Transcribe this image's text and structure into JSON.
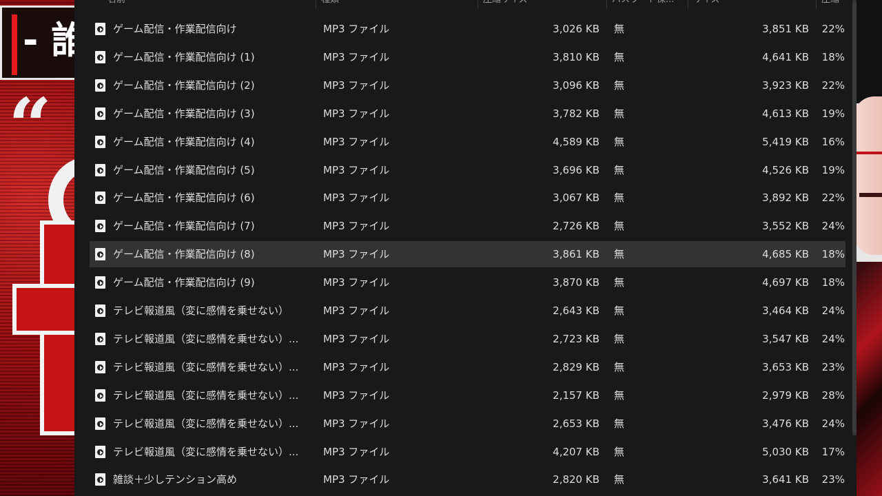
{
  "header": {
    "columns": [
      "名前",
      "種類",
      "圧縮サイズ",
      "パスワード保...",
      "サイズ",
      "圧縮"
    ]
  },
  "rows": [
    {
      "name": "ゲーム配信・作業配信向け",
      "type": "MP3 ファイル",
      "compressed": "3,026 KB",
      "password": "無",
      "size": "3,851 KB",
      "ratio": "22%"
    },
    {
      "name": "ゲーム配信・作業配信向け (1)",
      "type": "MP3 ファイル",
      "compressed": "3,810 KB",
      "password": "無",
      "size": "4,641 KB",
      "ratio": "18%"
    },
    {
      "name": "ゲーム配信・作業配信向け (2)",
      "type": "MP3 ファイル",
      "compressed": "3,096 KB",
      "password": "無",
      "size": "3,923 KB",
      "ratio": "22%"
    },
    {
      "name": "ゲーム配信・作業配信向け (3)",
      "type": "MP3 ファイル",
      "compressed": "3,782 KB",
      "password": "無",
      "size": "4,613 KB",
      "ratio": "19%"
    },
    {
      "name": "ゲーム配信・作業配信向け (4)",
      "type": "MP3 ファイル",
      "compressed": "4,589 KB",
      "password": "無",
      "size": "5,419 KB",
      "ratio": "16%"
    },
    {
      "name": "ゲーム配信・作業配信向け (5)",
      "type": "MP3 ファイル",
      "compressed": "3,696 KB",
      "password": "無",
      "size": "4,526 KB",
      "ratio": "19%"
    },
    {
      "name": "ゲーム配信・作業配信向け (6)",
      "type": "MP3 ファイル",
      "compressed": "3,067 KB",
      "password": "無",
      "size": "3,892 KB",
      "ratio": "22%"
    },
    {
      "name": "ゲーム配信・作業配信向け (7)",
      "type": "MP3 ファイル",
      "compressed": "2,726 KB",
      "password": "無",
      "size": "3,552 KB",
      "ratio": "24%"
    },
    {
      "name": "ゲーム配信・作業配信向け (8)",
      "type": "MP3 ファイル",
      "compressed": "3,861 KB",
      "password": "無",
      "size": "4,685 KB",
      "ratio": "18%",
      "selected": true
    },
    {
      "name": "ゲーム配信・作業配信向け (9)",
      "type": "MP3 ファイル",
      "compressed": "3,870 KB",
      "password": "無",
      "size": "4,697 KB",
      "ratio": "18%"
    },
    {
      "name": "テレビ報道風（変に感情を乗せない）",
      "type": "MP3 ファイル",
      "compressed": "2,643 KB",
      "password": "無",
      "size": "3,464 KB",
      "ratio": "24%"
    },
    {
      "name": "テレビ報道風（変に感情を乗せない）...",
      "type": "MP3 ファイル",
      "compressed": "2,723 KB",
      "password": "無",
      "size": "3,547 KB",
      "ratio": "24%"
    },
    {
      "name": "テレビ報道風（変に感情を乗せない）...",
      "type": "MP3 ファイル",
      "compressed": "2,829 KB",
      "password": "無",
      "size": "3,653 KB",
      "ratio": "23%"
    },
    {
      "name": "テレビ報道風（変に感情を乗せない）...",
      "type": "MP3 ファイル",
      "compressed": "2,157 KB",
      "password": "無",
      "size": "2,979 KB",
      "ratio": "28%"
    },
    {
      "name": "テレビ報道風（変に感情を乗せない）...",
      "type": "MP3 ファイル",
      "compressed": "2,653 KB",
      "password": "無",
      "size": "3,476 KB",
      "ratio": "24%"
    },
    {
      "name": "テレビ報道風（変に感情を乗せない）...",
      "type": "MP3 ファイル",
      "compressed": "4,207 KB",
      "password": "無",
      "size": "5,030 KB",
      "ratio": "17%"
    },
    {
      "name": "雑談＋少しテンション高め",
      "type": "MP3 ファイル",
      "compressed": "2,820 KB",
      "password": "無",
      "size": "3,641 KB",
      "ratio": "23%"
    }
  ],
  "background": {
    "title_text": "- 誰",
    "quote_mark": "“",
    "accent_color": "#c41414"
  }
}
